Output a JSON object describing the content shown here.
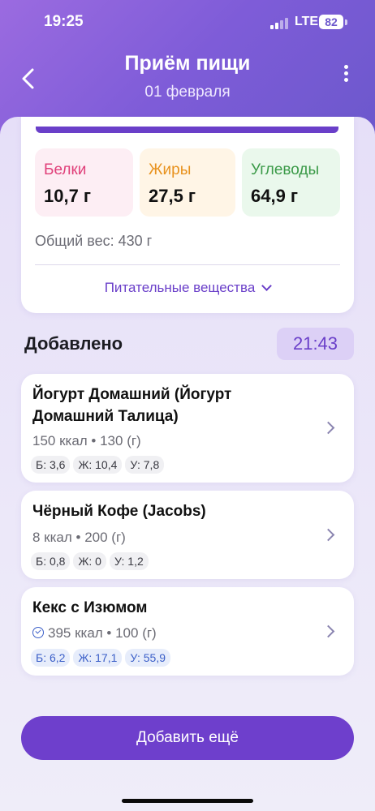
{
  "status_bar": {
    "time": "19:25",
    "network": "LTE",
    "battery": "82"
  },
  "header": {
    "title": "Приём пищи",
    "date": "01 февраля"
  },
  "summary": {
    "macros": [
      {
        "label": "Белки",
        "value": "10,7 г",
        "color": "#e0407a"
      },
      {
        "label": "Жиры",
        "value": "27,5 г",
        "color": "#e8921e"
      },
      {
        "label": "Углеводы",
        "value": "64,9 г",
        "color": "#3b9a48"
      }
    ],
    "total_weight": "Общий вес: 430 г",
    "nutrients_label": "Питательные вещества"
  },
  "added": {
    "label": "Добавлено",
    "time": "21:43"
  },
  "foods": [
    {
      "name": "Йогурт Домашний (Йогурт Домашний Талица)",
      "info": "150 ккал • 130 (г)",
      "chips": [
        "Б: 3,6",
        "Ж: 10,4",
        "У: 7,8"
      ]
    },
    {
      "name": "Чёрный Кофе (Jacobs)",
      "info": "8 ккал • 200 (г)",
      "chips": [
        "Б: 0,8",
        "Ж: 0",
        "У: 1,2"
      ]
    },
    {
      "name": "Кекс с Изюмом",
      "info": "395 ккал • 100 (г)",
      "verified": true,
      "chips": [
        "Б: 6,2",
        "Ж: 17,1",
        "У: 55,9"
      ]
    }
  ],
  "actions": {
    "add_more": "Добавить ещё"
  },
  "colors": {
    "accent": "#6e3fcc",
    "header_gradient_start": "#9b6be0",
    "header_gradient_end": "#6c58cc"
  }
}
